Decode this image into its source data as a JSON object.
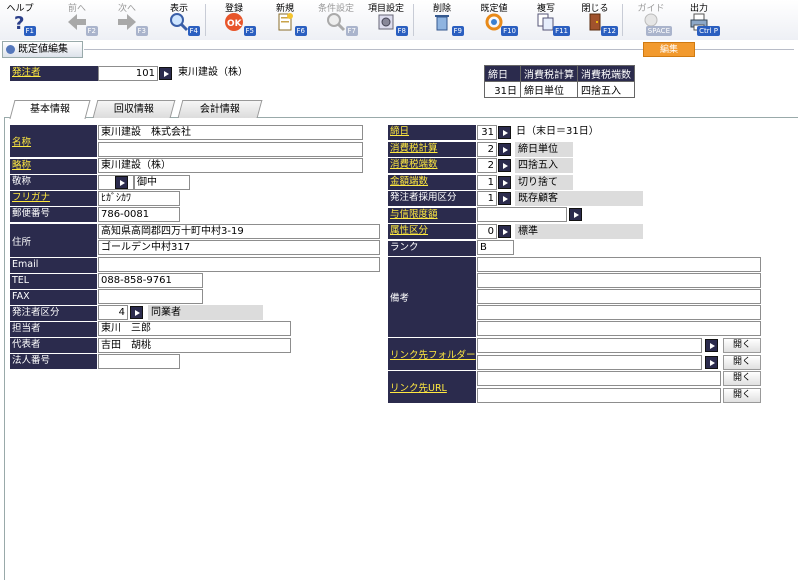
{
  "toolbar": {
    "items": [
      {
        "label": "ヘルプ",
        "key": "F1",
        "icon": "help-icon",
        "enabled": true
      },
      {
        "label": "前へ",
        "key": "F2",
        "icon": "arrow-left-icon",
        "enabled": false
      },
      {
        "label": "次へ",
        "key": "F3",
        "icon": "arrow-right-icon",
        "enabled": false
      },
      {
        "label": "表示",
        "key": "F4",
        "icon": "magnifier-icon",
        "enabled": true
      },
      {
        "label": "登録",
        "key": "F5",
        "icon": "ok-icon",
        "enabled": true
      },
      {
        "label": "新規",
        "key": "F6",
        "icon": "new-document-icon",
        "enabled": true
      },
      {
        "label": "条件設定",
        "key": "F7",
        "icon": "condition-search-icon",
        "enabled": false
      },
      {
        "label": "項目設定",
        "key": "F8",
        "icon": "gear-list-icon",
        "enabled": true
      },
      {
        "label": "削除",
        "key": "F9",
        "icon": "trash-icon",
        "enabled": true
      },
      {
        "label": "既定値",
        "key": "F10",
        "icon": "refresh-icon",
        "enabled": true
      },
      {
        "label": "複写",
        "key": "F11",
        "icon": "copy-icon",
        "enabled": true
      },
      {
        "label": "閉じる",
        "key": "F12",
        "icon": "door-icon",
        "enabled": true
      },
      {
        "label": "ガイド",
        "key": "SPACE",
        "icon": "lightbulb-icon",
        "enabled": false
      },
      {
        "label": "出力",
        "key": "Ctrl P",
        "icon": "printer-icon",
        "enabled": true
      }
    ]
  },
  "header": {
    "title": "既定値編集",
    "edit_label": "編集"
  },
  "top": {
    "orderer_label": "発注者",
    "orderer_code": "101",
    "orderer_name": "東川建設（株）"
  },
  "summary": {
    "headers": [
      "締日",
      "消費税計算",
      "消費税端数"
    ],
    "values": [
      "31日",
      "締日単位",
      "四捨五入"
    ]
  },
  "tabs": [
    "基本情報",
    "回収情報",
    "会計情報"
  ],
  "left": {
    "name_label": "名称",
    "name1": "東川建設　株式会社",
    "name2": "",
    "short_label": "略称",
    "short": "東川建設（株）",
    "honor_label": "敬称",
    "honor": "御中",
    "kana_label": "フリガナ",
    "kana": "ﾋｶﾞｼｶﾜ",
    "zip_label": "郵便番号",
    "zip": "786-0081",
    "addr_label": "住所",
    "addr1": "高知県高岡郡四万十町中村3-19",
    "addr2": "ゴールデン中村317",
    "email_label": "Email",
    "email": "",
    "tel_label": "TEL",
    "tel": "088-858-9761",
    "fax_label": "FAX",
    "fax": "",
    "ordtype_label": "発注者区分",
    "ordtype_code": "4",
    "ordtype_name": "同業者",
    "person_label": "担当者",
    "person": "東川　三郎",
    "rep_label": "代表者",
    "rep": "吉田　胡桃",
    "corp_label": "法人番号",
    "corp": ""
  },
  "right": {
    "close_label": "締日",
    "close_code": "31",
    "close_note": "日（末日＝31日）",
    "tax_calc_label": "消費税計算",
    "tax_calc_code": "2",
    "tax_calc_name": "締日単位",
    "tax_round_label": "消費税端数",
    "tax_round_code": "2",
    "tax_round_name": "四捨五入",
    "amt_round_label": "金額端数",
    "amt_round_code": "1",
    "amt_round_name": "切り捨て",
    "adopt_label": "発注者採用区分",
    "adopt_code": "1",
    "adopt_name": "既存顧客",
    "credit_label": "与信限度額",
    "credit": "",
    "attr_label": "属性区分",
    "attr_code": "0",
    "attr_name": "標準",
    "rank_label": "ランク",
    "rank": "B",
    "note_label": "備考",
    "link_folder_label": "リンク先フォルダー",
    "link_url_label": "リンク先URL",
    "open_label": "開く"
  }
}
